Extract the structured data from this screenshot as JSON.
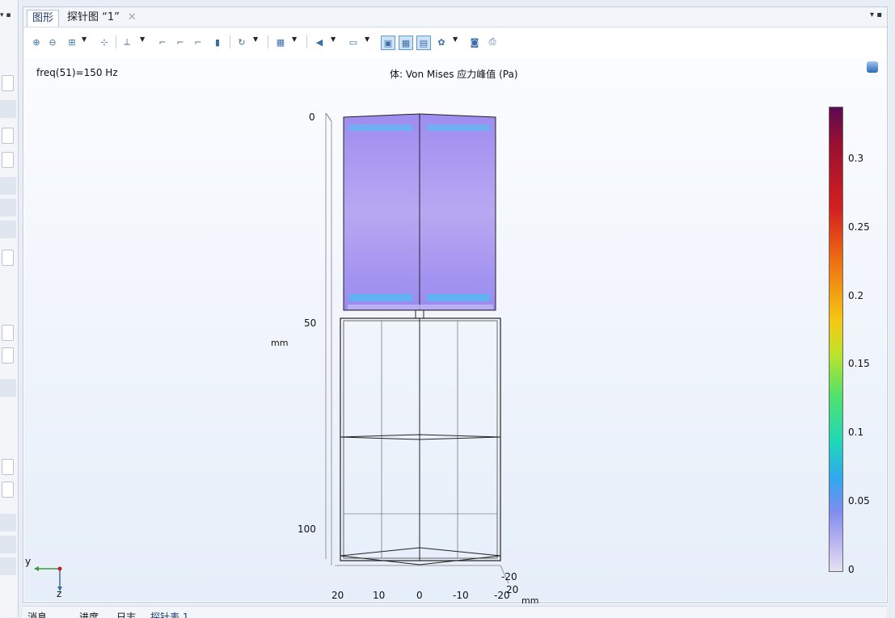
{
  "tabs": {
    "active": "图形",
    "other": "探针图 “1”"
  },
  "graphics": {
    "freq_label": "freq(51)=150 Hz",
    "plot_title": "体: Von Mises 应力峰值 (Pa)"
  },
  "vertical_axis": {
    "ticks": [
      "0",
      "50",
      "100"
    ],
    "unit": "mm"
  },
  "horizontal_axis": {
    "ticks": [
      "20",
      "10",
      "0",
      "-10",
      "-20"
    ],
    "unit": "mm"
  },
  "depth_axis": {
    "ticks": [
      "-20",
      "20"
    ]
  },
  "colorbar": {
    "ticks": [
      "0.3",
      "0.25",
      "0.2",
      "0.15",
      "0.1",
      "0.05",
      "0"
    ]
  },
  "triad": {
    "y": "y",
    "z": "z"
  },
  "bottom_tabs": [
    "消息",
    "进度",
    "日志",
    "探针表 1"
  ],
  "colors": {
    "accent": "#3a6ea5",
    "field": "#ad9cf2"
  }
}
